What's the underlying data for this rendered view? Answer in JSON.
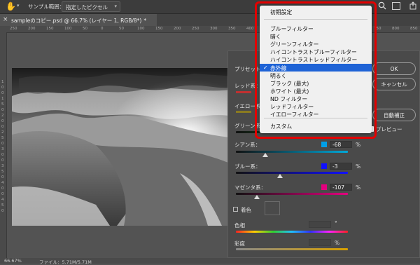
{
  "optionsbar": {
    "sample_label": "サンプル範囲：",
    "sample_value": "指定したピクセル"
  },
  "tab": {
    "close": "×",
    "title": "sampleのコピー.psd @ 66.7% (レイヤー 1, RGB/8*)",
    "modified": "*"
  },
  "rulers": {
    "h": [
      "250",
      "200",
      "150",
      "100",
      "50",
      "0",
      "50",
      "100",
      "150",
      "200",
      "250",
      "300",
      "350",
      "400",
      "450",
      "500",
      "550",
      "600",
      "650",
      "700",
      "750",
      "800",
      "850"
    ],
    "v": [
      "1",
      "0",
      "0",
      "1",
      "5",
      "0",
      "2",
      "0",
      "0",
      "2",
      "5",
      "0",
      "3",
      "0",
      "0",
      "3",
      "5",
      "0",
      "4",
      "0",
      "0",
      "4",
      "5",
      "0"
    ]
  },
  "dialog": {
    "preset_label": "プリセット：",
    "ok": "OK",
    "cancel": "キャンセル",
    "auto": "自動補正",
    "preview": "プレビュー",
    "red_label": "レッド系：",
    "yellow_label": "イエロー系：",
    "green_label": "グリーン系：",
    "cyan_label": "シアン系：",
    "cyan_value": "-68",
    "blue_label": "ブルー系：",
    "blue_value": "-3",
    "magenta_label": "マゼンタ系：",
    "magenta_value": "-107",
    "percent": "%",
    "tint_label": "着色",
    "hue_label": "色相",
    "hue_unit": "°",
    "sat_label": "彩度",
    "sat_unit": "%"
  },
  "sliders": {
    "cyan": -68,
    "blue": -3,
    "magenta": -107,
    "range": [
      -200,
      300
    ]
  },
  "menu": {
    "selected_index": 7,
    "check": "✓",
    "items": [
      "初期設定",
      "ブルーフィルター",
      "暗く",
      "グリーンフィルター",
      "ハイコントラストブルーフィルター",
      "ハイコントラストレッドフィルター",
      "赤外線",
      "明るく",
      "ブラック (最大)",
      "ホワイト (最大)",
      "ND フィルター",
      "レッドフィルター",
      "イエローフィルター",
      "カスタム"
    ]
  },
  "status": {
    "zoom": "66.67%",
    "file": "ファイル：5.71M/5.71M"
  },
  "colors": {
    "highlight_frame": "#e30000",
    "menu_selection": "#1e63d6",
    "cyan_swatch": "#00a0e9",
    "blue_swatch": "#1010ff",
    "magenta_swatch": "#e4007f"
  }
}
